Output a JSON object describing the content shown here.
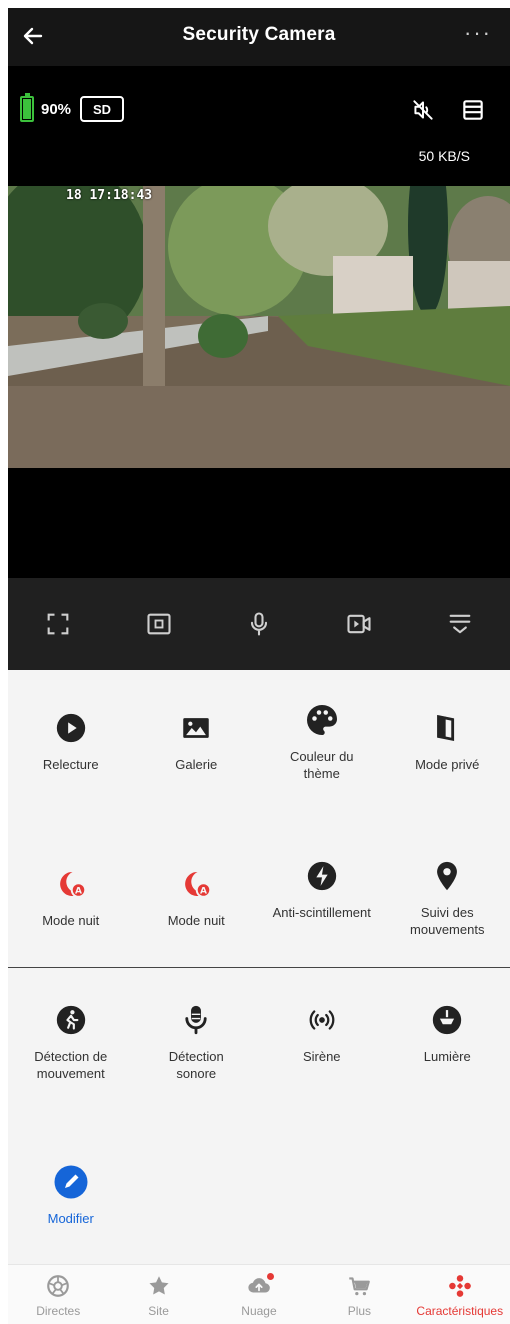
{
  "header": {
    "title": "Security Camera",
    "more": "···"
  },
  "live": {
    "battery_text": "90%",
    "battery_level": 0.9,
    "sd_label": "SD",
    "speed": "50 KB/S",
    "timestamp": "18 17:18:43"
  },
  "features": {
    "row1": [
      {
        "label": "Relecture",
        "icon": "play-circle-icon"
      },
      {
        "label": "Galerie",
        "icon": "image-icon"
      },
      {
        "label": "Couleur du thème",
        "icon": "palette-icon"
      },
      {
        "label": "Mode privé",
        "icon": "privacy-icon"
      }
    ],
    "row2": [
      {
        "label": "Mode nuit",
        "icon": "night-mode-icon"
      },
      {
        "label": "Mode nuit",
        "icon": "night-mode-icon"
      },
      {
        "label": "Anti-scintillement",
        "icon": "bolt-icon"
      },
      {
        "label": "Suivi des mouvements",
        "icon": "location-pin-icon"
      }
    ],
    "row3": [
      {
        "label": "Détection de mouvement",
        "icon": "walking-icon"
      },
      {
        "label": "Détection sonore",
        "icon": "microphone-icon"
      },
      {
        "label": "Sirène",
        "icon": "siren-icon"
      },
      {
        "label": "Lumière",
        "icon": "light-icon"
      }
    ],
    "row4": [
      {
        "label": "Modifier",
        "icon": "edit-icon"
      }
    ]
  },
  "nav": [
    {
      "label": "Directes",
      "icon": "aperture-icon"
    },
    {
      "label": "Site",
      "icon": "star-icon"
    },
    {
      "label": "Nuage",
      "icon": "cloud-upload-icon"
    },
    {
      "label": "Plus",
      "icon": "cart-icon"
    },
    {
      "label": "Caractéristiques",
      "icon": "features-icon"
    }
  ],
  "colors": {
    "accent_red": "#e53935",
    "accent_blue": "#1565d8",
    "battery_green": "#3cc13c"
  }
}
